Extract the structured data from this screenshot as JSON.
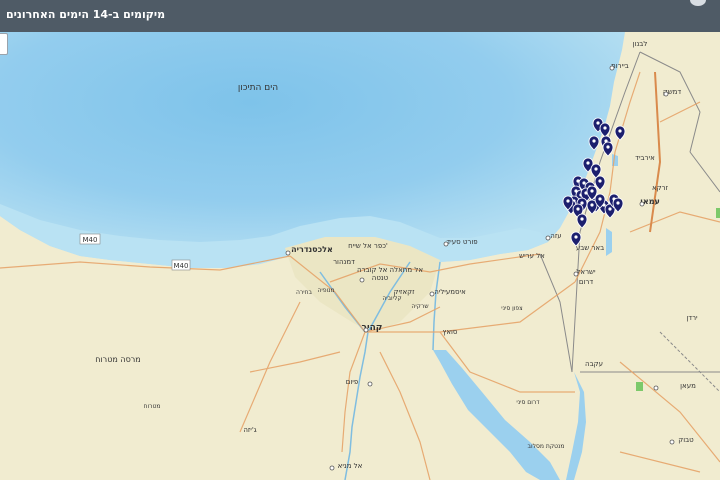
{
  "header": {
    "title": "מיקומים ב-14 הימים האחרונים"
  },
  "map": {
    "sea_label": "הים התיכון",
    "road_labels": [
      "M40",
      "M40"
    ],
    "places": [
      {
        "name": "לבנון"
      },
      {
        "name": "ביירות"
      },
      {
        "name": "דמשק"
      },
      {
        "name": "אירביד"
      },
      {
        "name": "זרקא"
      },
      {
        "name": "עמאן"
      },
      {
        "name": "באר שבע"
      },
      {
        "name": "עזה"
      },
      {
        "name": "ישראל"
      },
      {
        "name": "דרום"
      },
      {
        "name": "אל עריש"
      },
      {
        "name": "פורט סעיד"
      },
      {
        "name": "איסמעיליה"
      },
      {
        "name": "קהיר"
      },
      {
        "name": "אלכסנדריה"
      },
      {
        "name": "דמנהור"
      },
      {
        "name": "טנטה"
      },
      {
        "name": "זקאזיק"
      },
      {
        "name": "כפר אל שייח'"
      },
      {
        "name": "אל מחאלה אל קוברה"
      },
      {
        "name": "מרסה מטרוח"
      },
      {
        "name": "אל מניא"
      },
      {
        "name": "פיום"
      },
      {
        "name": "ג'יזה"
      },
      {
        "name": "סואץ"
      },
      {
        "name": "מנופיה"
      },
      {
        "name": "קליוביה"
      },
      {
        "name": "בחירה"
      },
      {
        "name": "שרקיה"
      },
      {
        "name": "צפון סיני"
      },
      {
        "name": "דרום סיני"
      },
      {
        "name": "מטרוח"
      },
      {
        "name": "מעאן"
      },
      {
        "name": "ירדן"
      },
      {
        "name": "טבוק"
      },
      {
        "name": "עקבה"
      },
      {
        "name": "מנטקת מסלוב"
      }
    ],
    "markers_count": 30,
    "colors": {
      "sea_deep": "#8cc8ea",
      "sea_shallow": "#b7e0f2",
      "land": "#f1ecd0",
      "roads": "#e6a46a",
      "borders": "#8a8a8a",
      "marker": "#1c1f6e",
      "header": "#4f5b66",
      "nile_delta": "#ebe6c4"
    }
  }
}
